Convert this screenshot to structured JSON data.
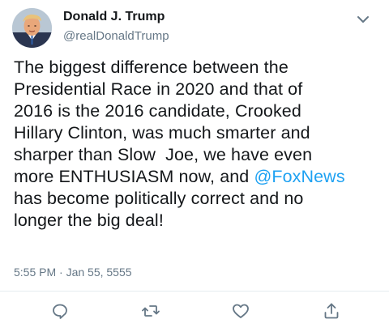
{
  "author": {
    "name": "Donald J. Trump",
    "handle": "@realDonaldTrump"
  },
  "tweet": {
    "lines": [
      "The biggest difference between the",
      "Presidential Race in 2020 and that of",
      "2016 is the 2016 candidate, Crooked",
      "Hillary Clinton, was much smarter and",
      "sharper than Slow  Joe, we have even",
      "more ENTHUSIASM now, and ",
      "has become politically correct and no",
      "longer the big deal!"
    ],
    "mention": "@FoxNews",
    "timestamp": "5:55 PM · Jan 55, 5555"
  },
  "actions": {
    "icons": [
      "reply-icon",
      "retweet-icon",
      "like-icon",
      "share-icon"
    ]
  },
  "colors": {
    "text": "#14171a",
    "secondary": "#657786",
    "link": "#1da1f2",
    "divider": "#e6ecf0"
  }
}
